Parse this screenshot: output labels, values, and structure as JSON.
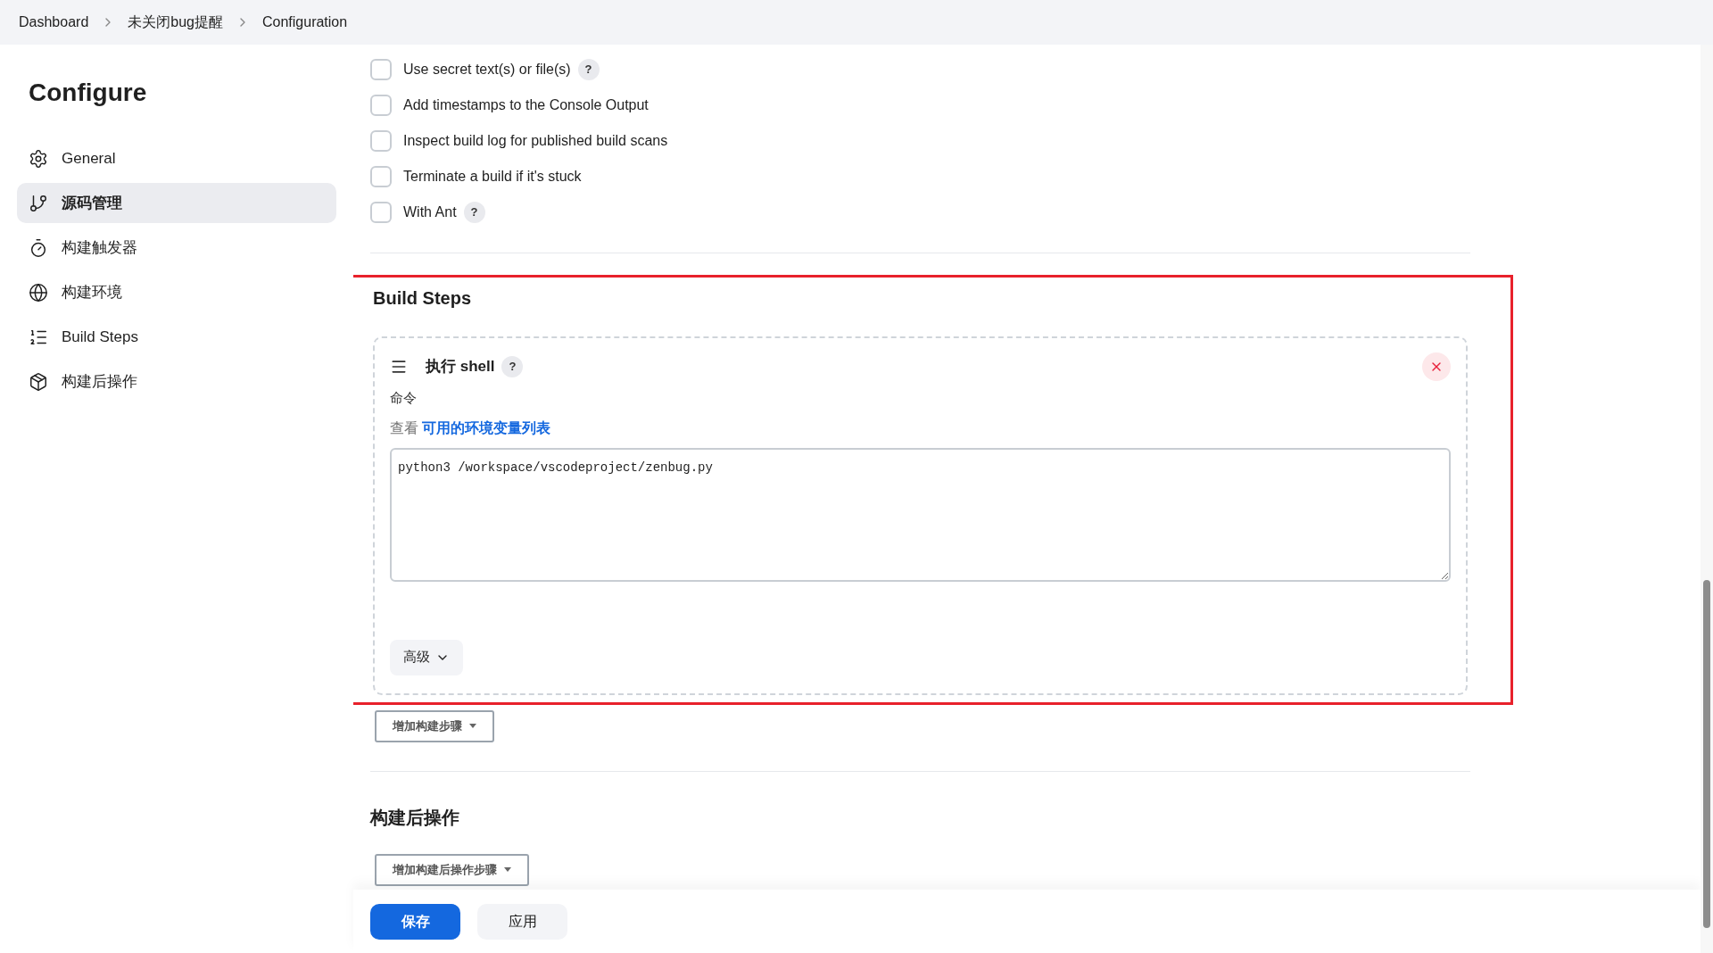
{
  "breadcrumbs": [
    {
      "label": "Dashboard"
    },
    {
      "label": "未关闭bug提醒"
    },
    {
      "label": "Configuration"
    }
  ],
  "sidebar": {
    "title": "Configure",
    "items": [
      {
        "label": "General",
        "selected": false
      },
      {
        "label": "源码管理",
        "selected": true
      },
      {
        "label": "构建触发器",
        "selected": false
      },
      {
        "label": "构建环境",
        "selected": false
      },
      {
        "label": "Build Steps",
        "selected": false
      },
      {
        "label": "构建后操作",
        "selected": false
      }
    ]
  },
  "options": [
    {
      "label": "Use secret text(s) or file(s)",
      "checked": false,
      "help": "?"
    },
    {
      "label": "Add timestamps to the Console Output",
      "checked": false
    },
    {
      "label": "Inspect build log for published build scans",
      "checked": false
    },
    {
      "label": "Terminate a build if it's stuck",
      "checked": false
    },
    {
      "label": "With Ant",
      "checked": false,
      "help": "?"
    }
  ],
  "build_steps": {
    "title": "Build Steps",
    "highlighted": true,
    "step": {
      "title": "执行 shell",
      "help": "?",
      "command_label": "命令",
      "env_hint_prefix": "查看",
      "env_link": "可用的环境变量列表",
      "command_value": "python3 /workspace/vscodeproject/zenbug.py",
      "advanced_button": "高级"
    },
    "add_button": "增加构建步骤"
  },
  "post_build": {
    "title": "构建后操作",
    "add_button": "增加构建后操作步骤"
  },
  "footer": {
    "buttons": [
      {
        "label": "保存",
        "kind": "primary"
      },
      {
        "label": "应用",
        "kind": "secondary"
      }
    ]
  }
}
